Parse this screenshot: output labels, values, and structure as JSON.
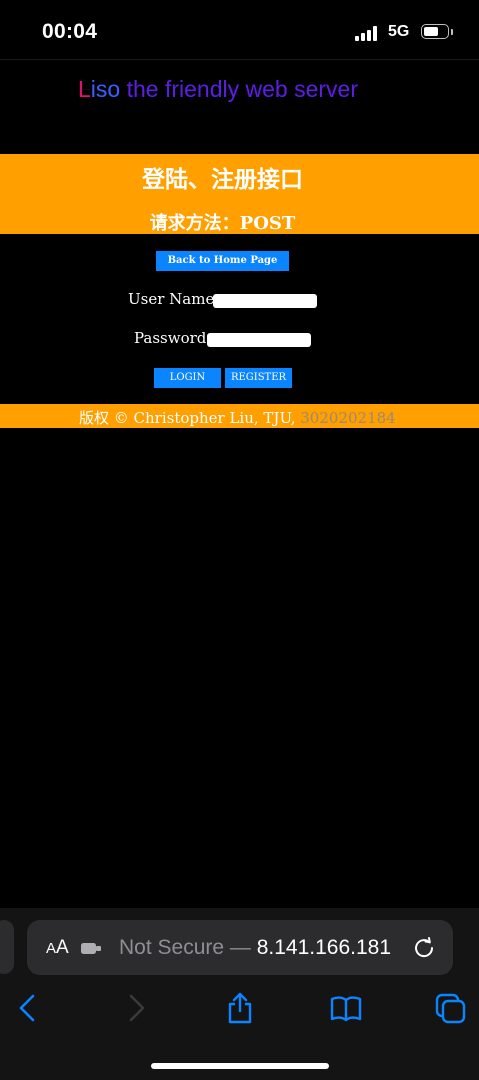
{
  "status_bar": {
    "time": "00:04",
    "network": "5G"
  },
  "page": {
    "logo": {
      "part1": "L",
      "part2": "iso",
      "rest": " the friendly web server"
    },
    "header": {
      "title": "登陆、注册接口",
      "method": "请求方法：POST"
    },
    "home_button": "Back to Home Page",
    "form": {
      "username_label": "User Name:",
      "username_value": "",
      "password_label": "Password:",
      "password_value": "",
      "login_button": "LOGIN",
      "register_button": "REGISTER"
    },
    "footer": {
      "text": "版权 © Christopher Liu, TJU, ",
      "student_id": "3020202184"
    },
    "colors": {
      "band": "#ff9f00",
      "button": "#0a84ff",
      "background": "#000000",
      "logo_accent": "#e0106e",
      "logo_main": "#5b1fe0"
    }
  },
  "browser": {
    "text_size_button": {
      "small": "A",
      "big": "A"
    },
    "url_warning": "Not Secure — ",
    "url_host": "8.141.166.181",
    "icons": {
      "extension": "extension-icon",
      "reload": "reload-icon",
      "back": "back-icon",
      "forward": "forward-icon",
      "share": "share-icon",
      "bookmarks": "bookmarks-icon",
      "tabs": "tabs-icon"
    }
  }
}
